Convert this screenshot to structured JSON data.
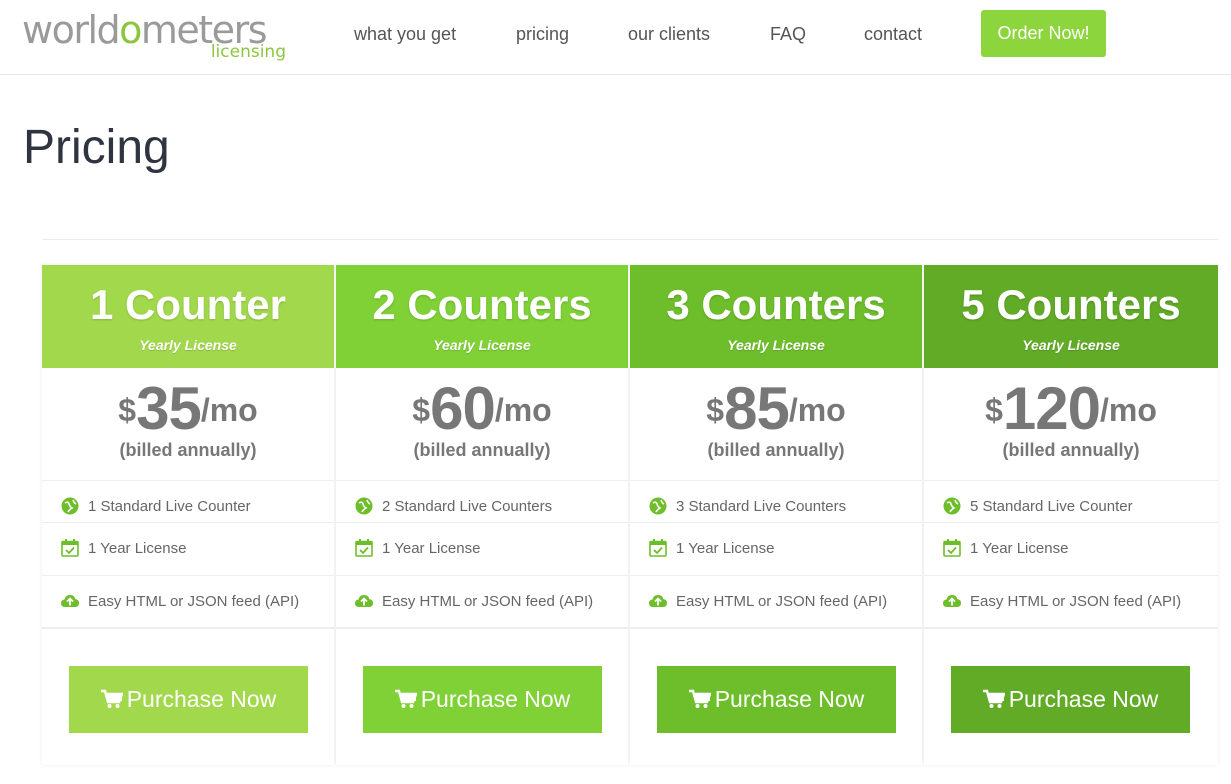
{
  "logo": {
    "main_pre": "world",
    "main_hl": "o",
    "main_post": "meters",
    "sub": "licensing"
  },
  "nav": {
    "items": [
      "what you get",
      "pricing",
      "our clients",
      "FAQ",
      "contact"
    ],
    "order_label": "Order Now!"
  },
  "page": {
    "title": "Pricing"
  },
  "colors": {
    "accent": "#8dd53d",
    "card1": "#a2d94c",
    "card2": "#7fd136",
    "card3": "#6ebe2c",
    "card4": "#62ab27"
  },
  "plans": [
    {
      "title": "1 Counter",
      "subtitle": "Yearly License",
      "currency": "$",
      "amount": "35",
      "per": "/mo",
      "billed": "(billed annually)",
      "features": [
        "1 Standard Live Counter",
        "1 Year License",
        "Easy HTML or JSON feed (API)"
      ],
      "button": "Purchase Now"
    },
    {
      "title": "2 Counters",
      "subtitle": "Yearly License",
      "currency": "$",
      "amount": "60",
      "per": "/mo",
      "billed": "(billed annually)",
      "features": [
        "2 Standard Live Counters",
        "1 Year License",
        "Easy HTML or JSON feed (API)"
      ],
      "button": "Purchase Now"
    },
    {
      "title": "3 Counters",
      "subtitle": "Yearly License",
      "currency": "$",
      "amount": "85",
      "per": "/mo",
      "billed": "(billed annually)",
      "features": [
        "3 Standard Live Counters",
        "1 Year License",
        "Easy HTML or JSON feed (API)"
      ],
      "button": "Purchase Now"
    },
    {
      "title": "5 Counters",
      "subtitle": "Yearly License",
      "currency": "$",
      "amount": "120",
      "per": "/mo",
      "billed": "(billed annually)",
      "features": [
        "5 Standard Live Counter",
        "1 Year License",
        "Easy HTML or JSON feed (API)"
      ],
      "button": "Purchase Now"
    }
  ],
  "icons": {
    "feature1": "globe-icon",
    "feature2": "calendar-check-icon",
    "feature3": "cloud-upload-icon",
    "button": "cart-icon"
  }
}
